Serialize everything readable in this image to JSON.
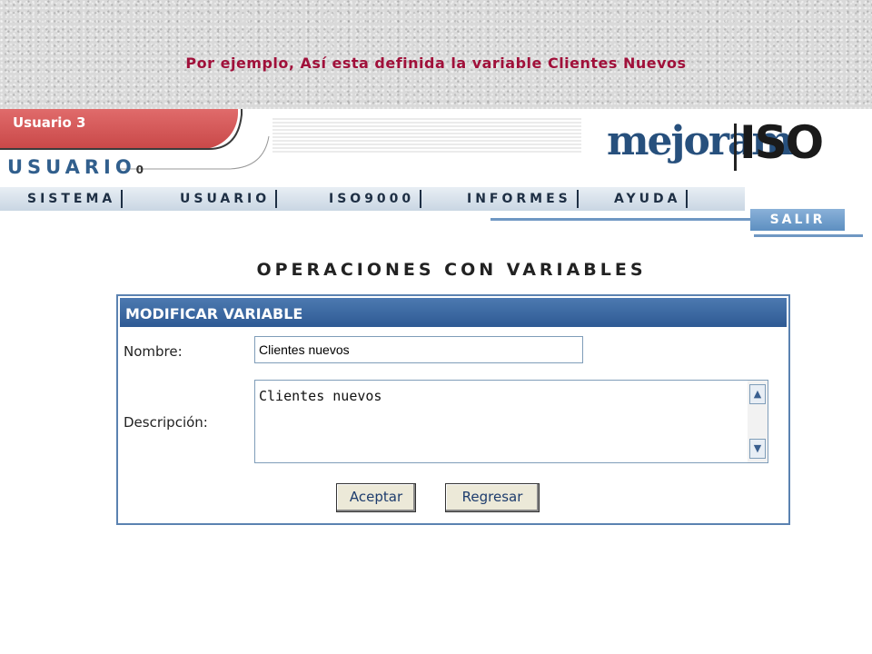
{
  "slide_title": "Por ejemplo, Así esta definida la variable Clientes Nuevos",
  "header": {
    "user_tab_label": "Usuario 3",
    "user_role": "USUARIO",
    "user_role_suffix": "0",
    "logo_left": "mejoram",
    "logo_right": "ISO"
  },
  "menu": {
    "items": [
      "SISTEMA",
      "USUARIO",
      "ISO9000",
      "INFORMES",
      "AYUDA"
    ],
    "logout_label": "SALIR"
  },
  "page_heading": "OPERACIONES CON VARIABLES",
  "form": {
    "title": "MODIFICAR VARIABLE",
    "name_label": "Nombre:",
    "name_value": "Clientes nuevos",
    "description_label": "Descripción:",
    "description_value": "Clientes nuevos",
    "accept_label": "Aceptar",
    "back_label": "Regresar"
  },
  "colors": {
    "title_red": "#a0103a",
    "panel_blue": "#2e5a94",
    "user_tab_red": "#c94848"
  }
}
